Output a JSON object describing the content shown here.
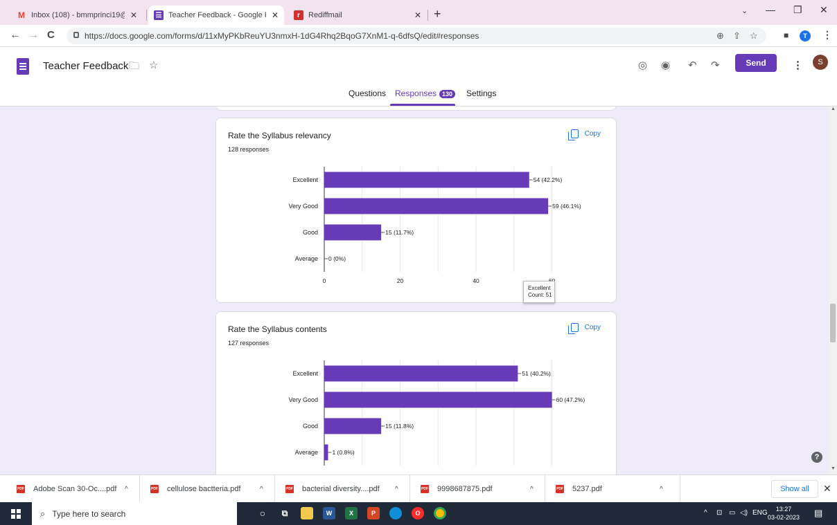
{
  "browser": {
    "tabs": [
      {
        "title": "Inbox (108) - bmmprinci19@gma",
        "favicon": "gmail-icon",
        "color": "#ea4335"
      },
      {
        "title": "Teacher Feedback - Google Form",
        "favicon": "forms-icon",
        "color": "#673ab7"
      },
      {
        "title": "Rediffmail",
        "favicon": "rediff-icon",
        "color": "#d32f2f"
      }
    ],
    "url": "https://docs.google.com/forms/d/11xMyPKbReuYU3nmxH-1dG4Rhq2BqoG7XnM1-q-6dfsQ/edit#responses"
  },
  "form": {
    "title": "Teacher Feedback",
    "send_label": "Send",
    "avatar_letter": "S",
    "profile_letter": "T",
    "tabs": {
      "questions": "Questions",
      "responses": "Responses",
      "responses_count": "130",
      "settings": "Settings"
    }
  },
  "chart_data": [
    {
      "type": "bar",
      "orientation": "horizontal",
      "title": "Rate the Syllabus relevancy",
      "subtitle": "128 responses",
      "categories": [
        "Excellent",
        "Very Good",
        "Good",
        "Average"
      ],
      "values": [
        54,
        59,
        15,
        0
      ],
      "labels": [
        "54 (42.2%)",
        "59 (46.1%)",
        "15 (11.7%)",
        "0 (0%)"
      ],
      "xticks": [
        0,
        20,
        40,
        60
      ],
      "xlim": [
        0,
        65
      ],
      "color": "#673ab7",
      "copy_label": "Copy"
    },
    {
      "type": "bar",
      "orientation": "horizontal",
      "title": "Rate the Syllabus contents",
      "subtitle": "127 responses",
      "categories": [
        "Excellent",
        "Very Good",
        "Good",
        "Average"
      ],
      "values": [
        51,
        60,
        15,
        1
      ],
      "labels": [
        "51 (40.2%)",
        "60 (47.2%)",
        "15 (11.8%)",
        "1 (0.8%)"
      ],
      "xlim": [
        0,
        65
      ],
      "color": "#673ab7",
      "copy_label": "Copy",
      "tooltip": {
        "line1": "Excellent",
        "line2": "Count: 51"
      }
    }
  ],
  "downloads": {
    "items": [
      "Adobe Scan 30-Oc....pdf",
      "cellulose bactteria.pdf",
      "bacterial diversity....pdf",
      "9998687875.pdf",
      "5237.pdf"
    ],
    "show_all": "Show all"
  },
  "taskbar": {
    "search_placeholder": "Type here to search",
    "lang": "ENG",
    "time": "13:27",
    "date": "03-02-2023"
  }
}
